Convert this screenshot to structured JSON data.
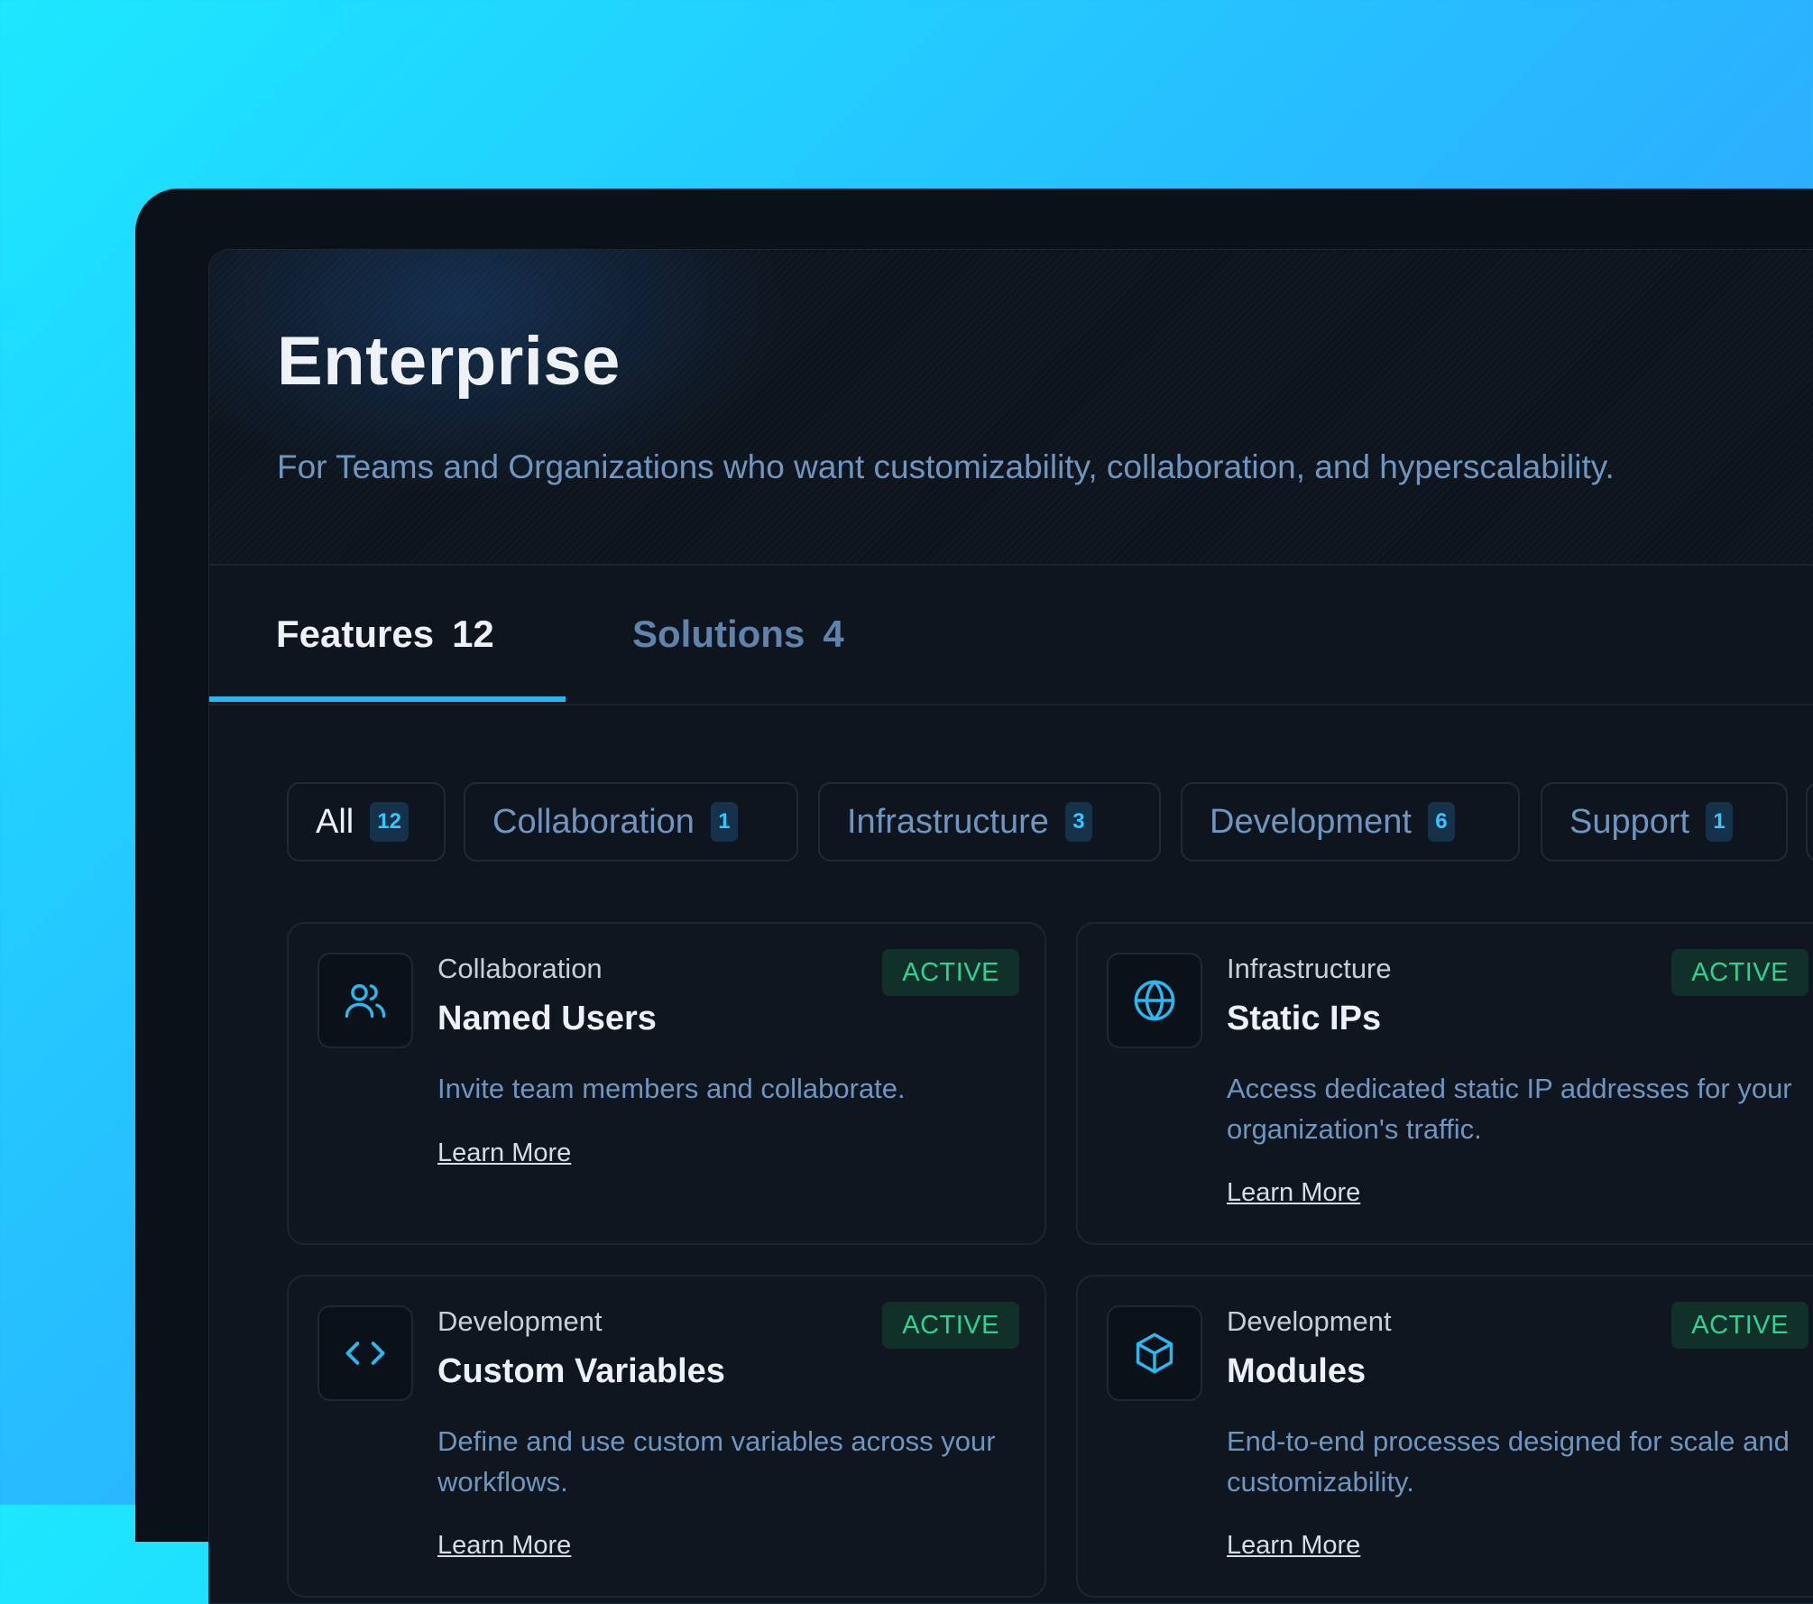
{
  "hero": {
    "title": "Enterprise",
    "subtitle": "For Teams and Organizations who want customizability, collaboration, and hyperscalability."
  },
  "tabs": [
    {
      "label": "Features",
      "count": "12",
      "active": true
    },
    {
      "label": "Solutions",
      "count": "4",
      "active": false
    }
  ],
  "filters": [
    {
      "label": "All",
      "count": "12",
      "active": true
    },
    {
      "label": "Collaboration",
      "count": "1",
      "active": false
    },
    {
      "label": "Infrastructure",
      "count": "3",
      "active": false
    },
    {
      "label": "Development",
      "count": "6",
      "active": false
    },
    {
      "label": "Support",
      "count": "1",
      "active": false
    }
  ],
  "cards": [
    {
      "icon": "users-icon",
      "category": "Collaboration",
      "title": "Named Users",
      "status": "ACTIVE",
      "description": "Invite team members and collaborate.",
      "link": "Learn More"
    },
    {
      "icon": "globe-icon",
      "category": "Infrastructure",
      "title": "Static IPs",
      "status": "ACTIVE",
      "description": "Access dedicated static IP addresses for your organization's traffic.",
      "link": "Learn More"
    },
    {
      "icon": "code-icon",
      "category": "Development",
      "title": "Custom Variables",
      "status": "ACTIVE",
      "description": "Define and use custom variables across your workflows.",
      "link": "Learn More"
    },
    {
      "icon": "cube-icon",
      "category": "Development",
      "title": "Modules",
      "status": "ACTIVE",
      "description": "End-to-end processes designed for scale and customizability.",
      "link": "Learn More"
    }
  ],
  "colors": {
    "accent": "#29b6f0",
    "active_status": "#2fd391",
    "muted_text": "#6e96c0"
  }
}
